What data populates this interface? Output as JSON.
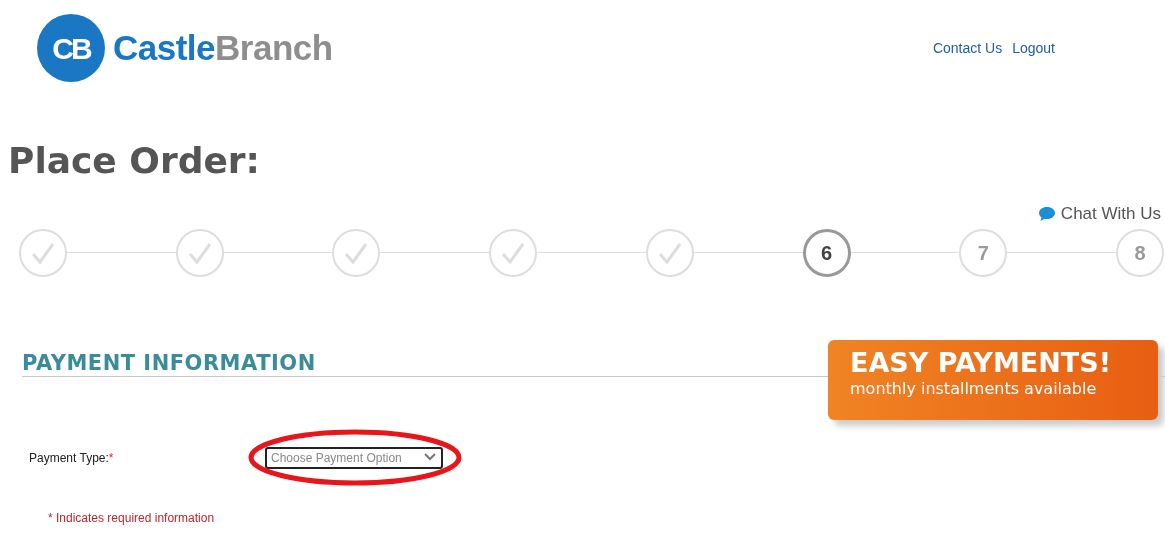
{
  "header": {
    "logo_mark": "CB",
    "logo_words": [
      "Castle",
      "Branch"
    ],
    "links": [
      "Contact Us",
      "Logout"
    ]
  },
  "title": "Place Order:",
  "chat": "Chat With Us",
  "steps": [
    {
      "completed": true,
      "current": false
    },
    {
      "completed": true,
      "current": false
    },
    {
      "completed": true,
      "current": false
    },
    {
      "completed": true,
      "current": false
    },
    {
      "completed": true,
      "current": false
    },
    {
      "completed": false,
      "current": true,
      "label": "6"
    },
    {
      "completed": false,
      "current": false,
      "label": "7"
    },
    {
      "completed": false,
      "current": false,
      "label": "8"
    }
  ],
  "section": {
    "heading": "PAYMENT INFORMATION",
    "banner": {
      "headline": "EASY PAYMENTS!",
      "subline": "monthly installments available"
    },
    "field": {
      "label": "Payment Type:",
      "required_mark": "*",
      "placeholder": "Choose Payment Option",
      "highlighted": true
    },
    "note": "* Indicates required information"
  }
}
